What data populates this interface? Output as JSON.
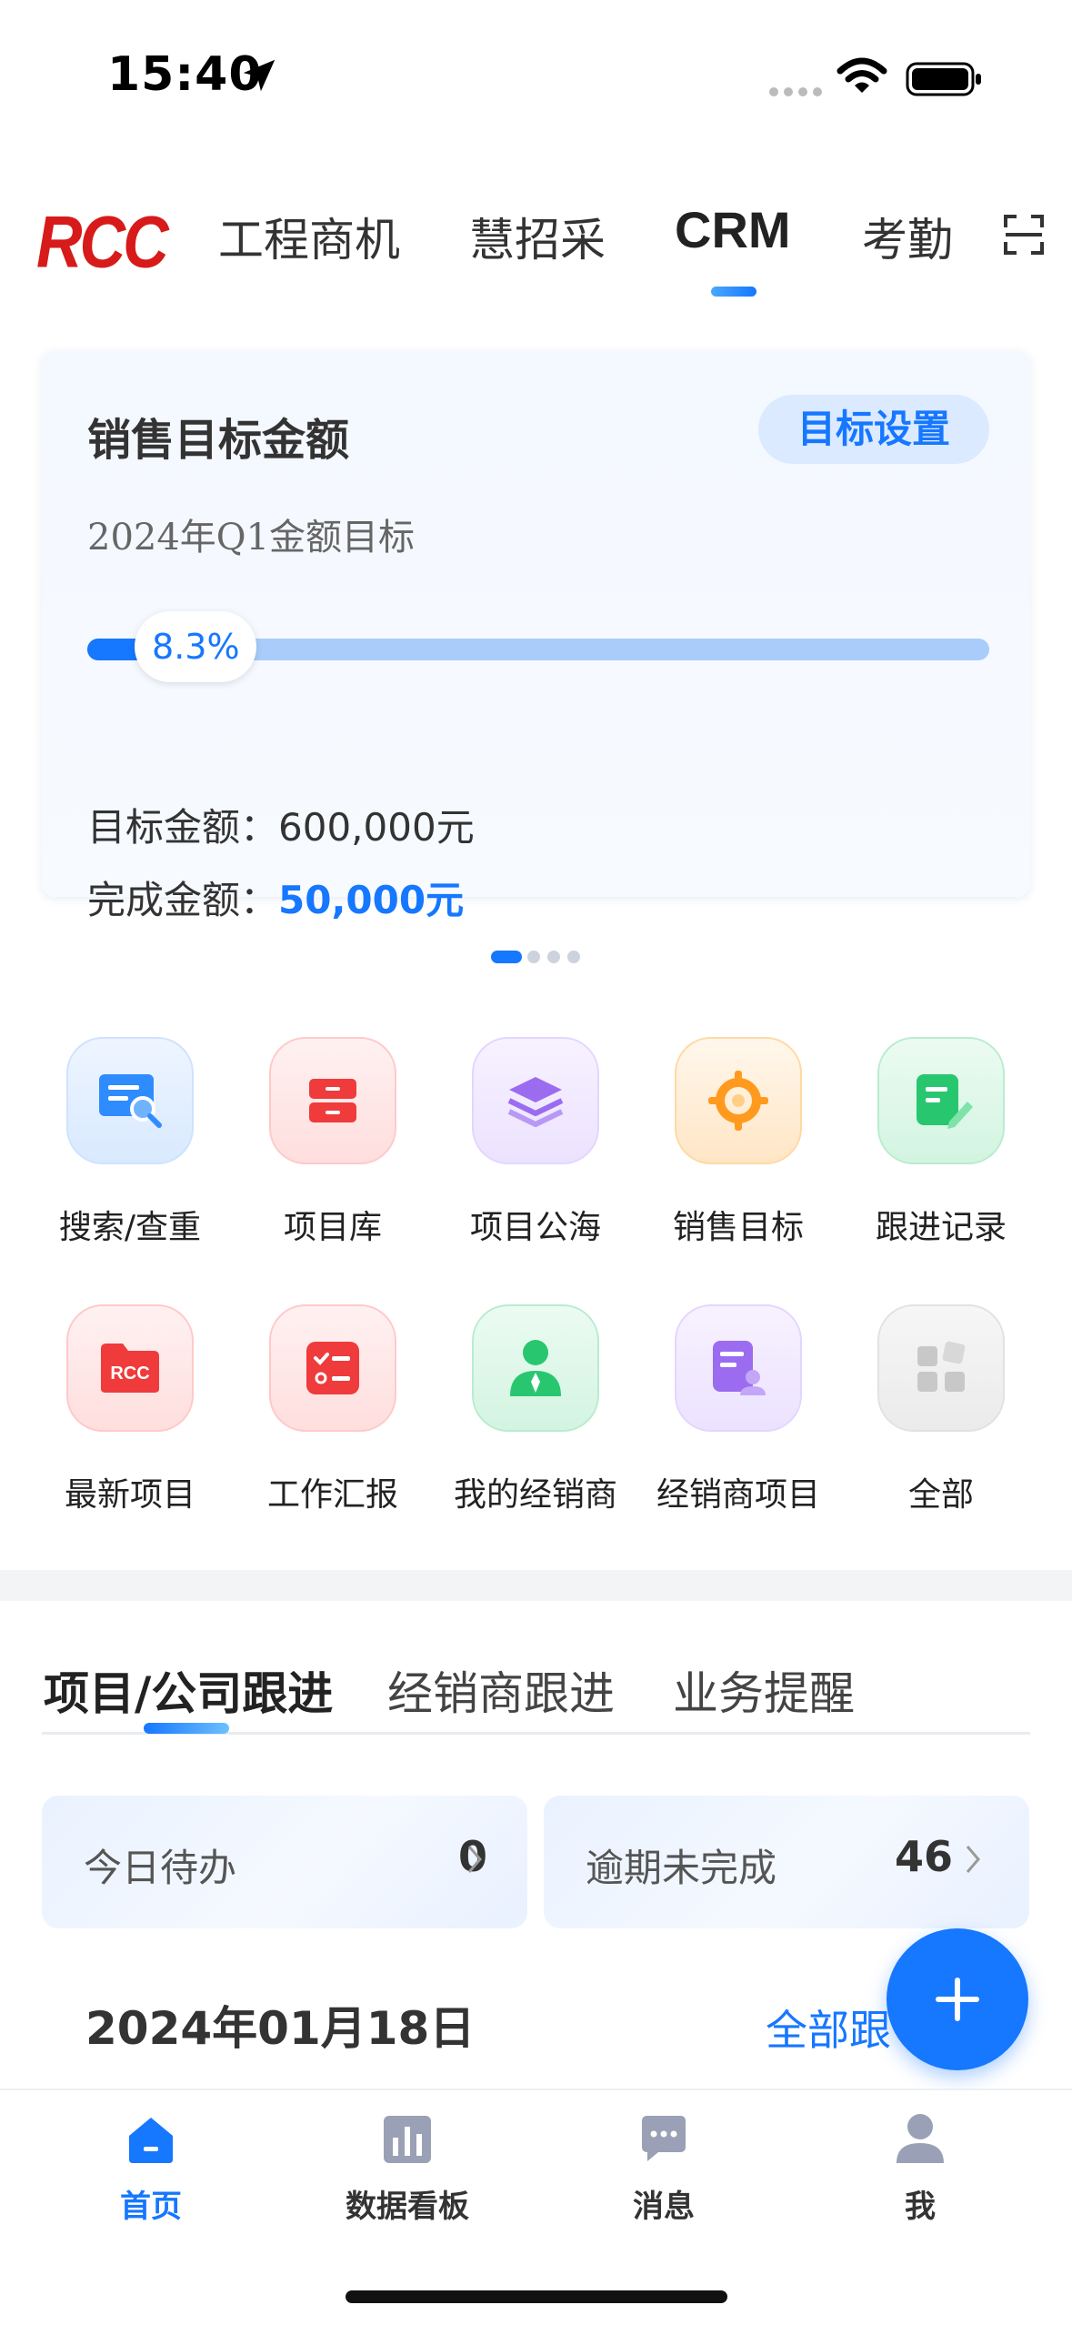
{
  "status_bar": {
    "time": "15:40"
  },
  "top_nav": {
    "logo": "RCC",
    "tabs": [
      {
        "label": "工程商机"
      },
      {
        "label": "慧招采"
      },
      {
        "label": "CRM"
      },
      {
        "label": "考勤"
      }
    ],
    "active_tab": "CRM"
  },
  "sales_card": {
    "title": "销售目标金额",
    "target_button": "目标设置",
    "subtitle": "2024年Q1金额目标",
    "progress_label": "8.3%",
    "progress_fraction": 0.083,
    "target_label": "目标金额：",
    "target_value": "600,000元",
    "done_label": "完成金额：",
    "done_value": "50,000元"
  },
  "pager": {
    "count": 4,
    "active": 0
  },
  "grid": {
    "items": [
      {
        "label": "搜索/查重",
        "icon": "search-doc-icon",
        "color": "#2f8cff"
      },
      {
        "label": "项目库",
        "icon": "cabinet-icon",
        "color": "#ef3b3b"
      },
      {
        "label": "项目公海",
        "icon": "layers-icon",
        "color": "#9b6cf0"
      },
      {
        "label": "销售目标",
        "icon": "target-icon",
        "color": "#ff9a1e"
      },
      {
        "label": "跟进记录",
        "icon": "note-edit-icon",
        "color": "#28c76f"
      },
      {
        "label": "最新项目",
        "icon": "rcc-folder-icon",
        "color": "#ef3b3b"
      },
      {
        "label": "工作汇报",
        "icon": "checklist-icon",
        "color": "#ef3b3b"
      },
      {
        "label": "我的经销商",
        "icon": "dealer-person-icon",
        "color": "#28c76f"
      },
      {
        "label": "经销商项目",
        "icon": "dealer-doc-icon",
        "color": "#9b6cf0"
      },
      {
        "label": "全部",
        "icon": "all-apps-icon",
        "color": "#c8c8c8"
      }
    ]
  },
  "follow": {
    "tabs": [
      {
        "label": "项目/公司跟进"
      },
      {
        "label": "经销商跟进"
      },
      {
        "label": "业务提醒"
      }
    ],
    "today": {
      "label": "今日待办",
      "value": "0"
    },
    "overdue": {
      "label": "逾期未完成",
      "value": "46"
    },
    "date": "2024年01月18日",
    "all_link": "全部跟"
  },
  "bottom_nav": {
    "items": [
      {
        "label": "首页",
        "icon": "home-icon"
      },
      {
        "label": "数据看板",
        "icon": "chart-board-icon"
      },
      {
        "label": "消息",
        "icon": "message-icon"
      },
      {
        "label": "我",
        "icon": "profile-icon"
      }
    ],
    "active": 0
  },
  "colors": {
    "accent": "#1677ff",
    "brand_red": "#d71a1a"
  }
}
